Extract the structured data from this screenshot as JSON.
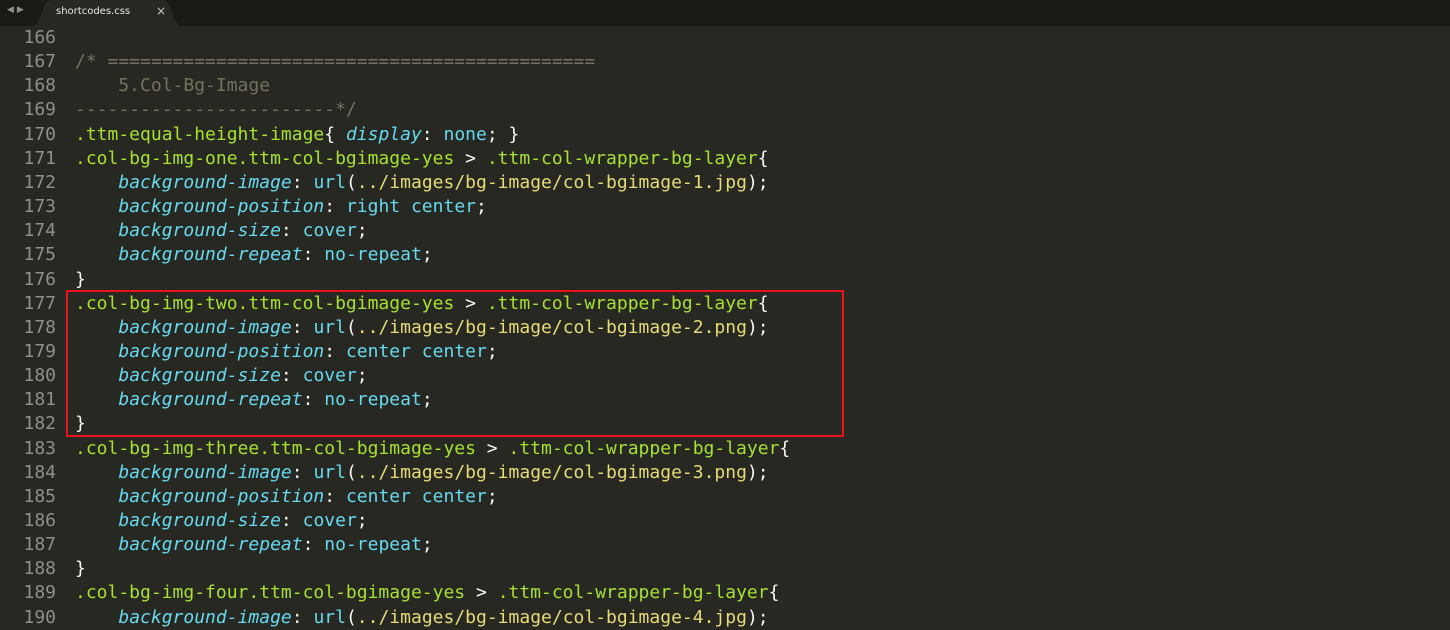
{
  "window": {
    "tab_title": "shortcodes.css",
    "close_glyph": "×",
    "nav_back_glyph": "◀",
    "nav_forward_glyph": "▶"
  },
  "colors": {
    "background": "#272822",
    "tabbar": "#191a16",
    "selector": "#a6e22e",
    "property": "#66d9ef",
    "string": "#e6db74",
    "comment": "#75715e",
    "line_number": "#90908a",
    "highlight_border": "#e8141b"
  },
  "editor": {
    "highlighted_lines": [
      177,
      182
    ],
    "lines": [
      {
        "num": "166",
        "tokens": []
      },
      {
        "num": "167",
        "tokens": [
          {
            "t": "cmt",
            "v": "/* ============================================="
          }
        ]
      },
      {
        "num": "168",
        "tokens": [
          {
            "t": "cmt",
            "v": "    5.Col-Bg-Image"
          }
        ]
      },
      {
        "num": "169",
        "tokens": [
          {
            "t": "cmt",
            "v": "------------------------*/"
          }
        ]
      },
      {
        "num": "170",
        "tokens": [
          {
            "t": "sel",
            "v": ".ttm-equal-height-image"
          },
          {
            "t": "pun",
            "v": "{ "
          },
          {
            "t": "prop",
            "v": "display"
          },
          {
            "t": "pun",
            "v": ": "
          },
          {
            "t": "val",
            "v": "none"
          },
          {
            "t": "pun",
            "v": "; }"
          }
        ]
      },
      {
        "num": "171",
        "tokens": [
          {
            "t": "sel",
            "v": ".col-bg-img-one.ttm-col-bgimage-yes"
          },
          {
            "t": "pun",
            "v": " > "
          },
          {
            "t": "sel",
            "v": ".ttm-col-wrapper-bg-layer"
          },
          {
            "t": "pun",
            "v": "{"
          }
        ]
      },
      {
        "num": "172",
        "tokens": [
          {
            "t": "pun",
            "v": "    "
          },
          {
            "t": "prop",
            "v": "background-image"
          },
          {
            "t": "pun",
            "v": ": "
          },
          {
            "t": "fn",
            "v": "url"
          },
          {
            "t": "pun",
            "v": "("
          },
          {
            "t": "str",
            "v": "../images/bg-image/col-bgimage-1.jpg"
          },
          {
            "t": "pun",
            "v": ");"
          }
        ]
      },
      {
        "num": "173",
        "tokens": [
          {
            "t": "pun",
            "v": "    "
          },
          {
            "t": "prop",
            "v": "background-position"
          },
          {
            "t": "pun",
            "v": ": "
          },
          {
            "t": "val",
            "v": "right center"
          },
          {
            "t": "pun",
            "v": ";"
          }
        ]
      },
      {
        "num": "174",
        "tokens": [
          {
            "t": "pun",
            "v": "    "
          },
          {
            "t": "prop",
            "v": "background-size"
          },
          {
            "t": "pun",
            "v": ": "
          },
          {
            "t": "val",
            "v": "cover"
          },
          {
            "t": "pun",
            "v": ";"
          }
        ]
      },
      {
        "num": "175",
        "tokens": [
          {
            "t": "pun",
            "v": "    "
          },
          {
            "t": "prop",
            "v": "background-repeat"
          },
          {
            "t": "pun",
            "v": ": "
          },
          {
            "t": "val",
            "v": "no-repeat"
          },
          {
            "t": "pun",
            "v": ";"
          }
        ]
      },
      {
        "num": "176",
        "tokens": [
          {
            "t": "pun",
            "v": "}"
          }
        ]
      },
      {
        "num": "177",
        "tokens": [
          {
            "t": "sel",
            "v": ".col-bg-img-two.ttm-col-bgimage-yes"
          },
          {
            "t": "pun",
            "v": " > "
          },
          {
            "t": "sel",
            "v": ".ttm-col-wrapper-bg-layer"
          },
          {
            "t": "pun",
            "v": "{"
          }
        ]
      },
      {
        "num": "178",
        "tokens": [
          {
            "t": "pun",
            "v": "    "
          },
          {
            "t": "prop",
            "v": "background-image"
          },
          {
            "t": "pun",
            "v": ": "
          },
          {
            "t": "fn",
            "v": "url"
          },
          {
            "t": "pun",
            "v": "("
          },
          {
            "t": "str",
            "v": "../images/bg-image/col-bgimage-2.png"
          },
          {
            "t": "pun",
            "v": ");"
          }
        ]
      },
      {
        "num": "179",
        "tokens": [
          {
            "t": "pun",
            "v": "    "
          },
          {
            "t": "prop",
            "v": "background-position"
          },
          {
            "t": "pun",
            "v": ": "
          },
          {
            "t": "val",
            "v": "center center"
          },
          {
            "t": "pun",
            "v": ";"
          }
        ]
      },
      {
        "num": "180",
        "tokens": [
          {
            "t": "pun",
            "v": "    "
          },
          {
            "t": "prop",
            "v": "background-size"
          },
          {
            "t": "pun",
            "v": ": "
          },
          {
            "t": "val",
            "v": "cover"
          },
          {
            "t": "pun",
            "v": ";"
          }
        ]
      },
      {
        "num": "181",
        "tokens": [
          {
            "t": "pun",
            "v": "    "
          },
          {
            "t": "prop",
            "v": "background-repeat"
          },
          {
            "t": "pun",
            "v": ": "
          },
          {
            "t": "val",
            "v": "no-repeat"
          },
          {
            "t": "pun",
            "v": ";"
          }
        ]
      },
      {
        "num": "182",
        "tokens": [
          {
            "t": "pun",
            "v": "}"
          }
        ]
      },
      {
        "num": "183",
        "tokens": [
          {
            "t": "sel",
            "v": ".col-bg-img-three.ttm-col-bgimage-yes"
          },
          {
            "t": "pun",
            "v": " > "
          },
          {
            "t": "sel",
            "v": ".ttm-col-wrapper-bg-layer"
          },
          {
            "t": "pun",
            "v": "{"
          }
        ]
      },
      {
        "num": "184",
        "tokens": [
          {
            "t": "pun",
            "v": "    "
          },
          {
            "t": "prop",
            "v": "background-image"
          },
          {
            "t": "pun",
            "v": ": "
          },
          {
            "t": "fn",
            "v": "url"
          },
          {
            "t": "pun",
            "v": "("
          },
          {
            "t": "str",
            "v": "../images/bg-image/col-bgimage-3.png"
          },
          {
            "t": "pun",
            "v": ");"
          }
        ]
      },
      {
        "num": "185",
        "tokens": [
          {
            "t": "pun",
            "v": "    "
          },
          {
            "t": "prop",
            "v": "background-position"
          },
          {
            "t": "pun",
            "v": ": "
          },
          {
            "t": "val",
            "v": "center center"
          },
          {
            "t": "pun",
            "v": ";"
          }
        ]
      },
      {
        "num": "186",
        "tokens": [
          {
            "t": "pun",
            "v": "    "
          },
          {
            "t": "prop",
            "v": "background-size"
          },
          {
            "t": "pun",
            "v": ": "
          },
          {
            "t": "val",
            "v": "cover"
          },
          {
            "t": "pun",
            "v": ";"
          }
        ]
      },
      {
        "num": "187",
        "tokens": [
          {
            "t": "pun",
            "v": "    "
          },
          {
            "t": "prop",
            "v": "background-repeat"
          },
          {
            "t": "pun",
            "v": ": "
          },
          {
            "t": "val",
            "v": "no-repeat"
          },
          {
            "t": "pun",
            "v": ";"
          }
        ]
      },
      {
        "num": "188",
        "tokens": [
          {
            "t": "pun",
            "v": "}"
          }
        ]
      },
      {
        "num": "189",
        "tokens": [
          {
            "t": "sel",
            "v": ".col-bg-img-four.ttm-col-bgimage-yes"
          },
          {
            "t": "pun",
            "v": " > "
          },
          {
            "t": "sel",
            "v": ".ttm-col-wrapper-bg-layer"
          },
          {
            "t": "pun",
            "v": "{"
          }
        ]
      },
      {
        "num": "190",
        "tokens": [
          {
            "t": "pun",
            "v": "    "
          },
          {
            "t": "prop",
            "v": "background-image"
          },
          {
            "t": "pun",
            "v": ": "
          },
          {
            "t": "fn",
            "v": "url"
          },
          {
            "t": "pun",
            "v": "("
          },
          {
            "t": "str",
            "v": "../images/bg-image/col-bgimage-4.jpg"
          },
          {
            "t": "pun",
            "v": ");"
          }
        ]
      }
    ]
  }
}
